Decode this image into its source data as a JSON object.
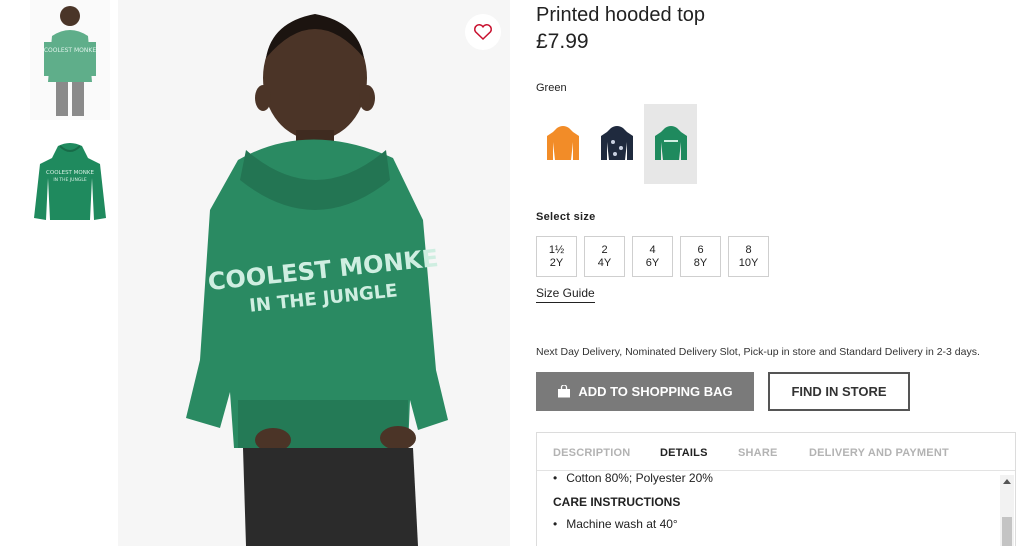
{
  "product": {
    "title": "Printed hooded top",
    "price": "£7.99",
    "color_label": "Green",
    "swatches": [
      {
        "name": "orange",
        "color": "#f28c28"
      },
      {
        "name": "navy",
        "color": "#1f2a3e"
      },
      {
        "name": "green",
        "color": "#1f8a5e",
        "selected": true
      }
    ],
    "hoodie_print": [
      "COOLEST MONKE",
      "IN THE JUNGLE"
    ],
    "size_label": "Select size",
    "sizes": [
      {
        "line1": "1½",
        "line2": "2Y"
      },
      {
        "line1": "2",
        "line2": "4Y"
      },
      {
        "line1": "4",
        "line2": "6Y"
      },
      {
        "line1": "6",
        "line2": "8Y"
      },
      {
        "line1": "8",
        "line2": "10Y"
      }
    ],
    "size_guide": "Size Guide",
    "delivery_text": "Next Day Delivery, Nominated Delivery Slot, Pick-up in store and Standard Delivery in 2-3 days.",
    "add_to_bag": "ADD TO SHOPPING BAG",
    "find_in_store": "FIND IN STORE"
  },
  "tabs": [
    {
      "label": "DESCRIPTION"
    },
    {
      "label": "DETAILS",
      "active": true
    },
    {
      "label": "SHARE"
    },
    {
      "label": "DELIVERY AND PAYMENT"
    }
  ],
  "details": {
    "composition": "Cotton 80%; Polyester 20%",
    "care_heading": "CARE INSTRUCTIONS",
    "care_item": "Machine wash at 40°"
  },
  "colors": {
    "hoodie_green": "#2a8a62",
    "button_grey": "#7a7a7a",
    "heart": "#c8102e"
  }
}
